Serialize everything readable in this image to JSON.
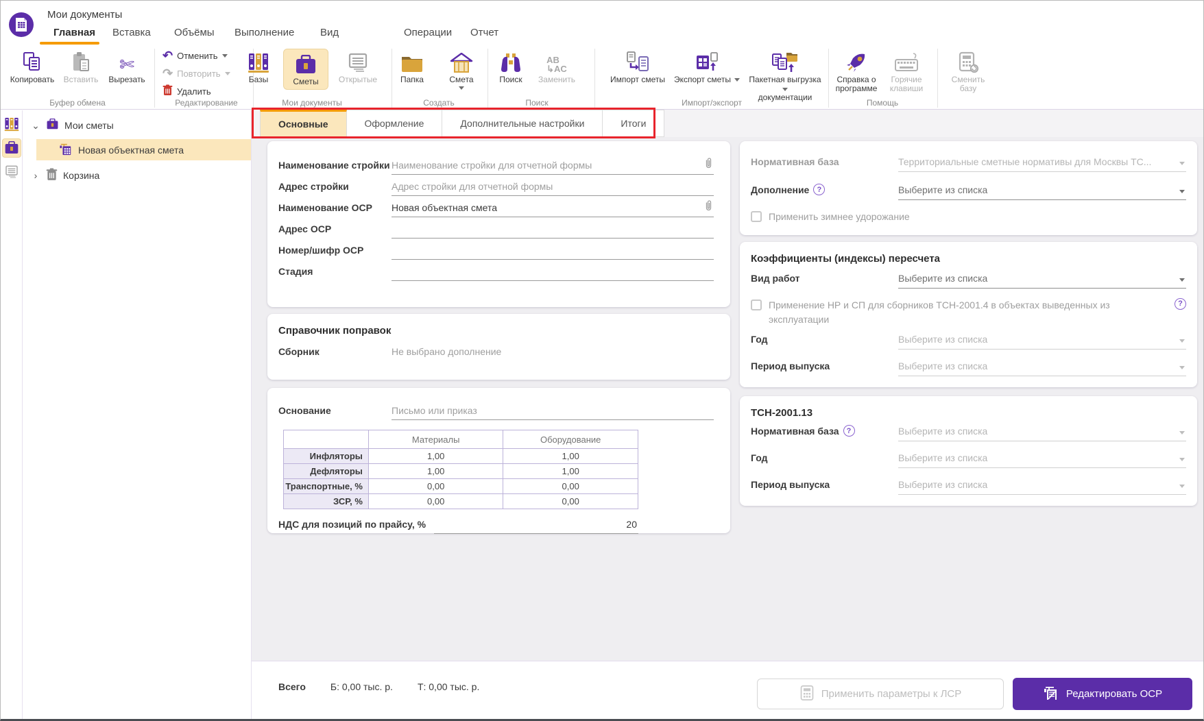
{
  "colors": {
    "accent": "#5b2da8",
    "highlight": "#fbe7bc",
    "active_tab_bar": "#f59b00",
    "annotation": "#e8242c",
    "gold": "#d9a43b"
  },
  "window": {
    "title": "Мои документы"
  },
  "ribbon": {
    "tabs": [
      {
        "label": "Главная"
      },
      {
        "label": "Вставка"
      },
      {
        "label": "Объёмы"
      },
      {
        "label": "Выполнение"
      },
      {
        "label": "Вид"
      },
      {
        "label": "Операции"
      },
      {
        "label": "Отчет"
      }
    ],
    "clipboard": {
      "label": "Буфер обмена",
      "copy": "Копировать",
      "paste": "Вставить",
      "cut": "Вырезать"
    },
    "editing": {
      "label": "Редактирование",
      "undo": "Отменить",
      "redo": "Повторить",
      "delete": "Удалить"
    },
    "documents": {
      "label": "Мои документы",
      "bases": "Базы",
      "estimates": "Сметы",
      "open": "Открытые"
    },
    "create": {
      "label": "Создать",
      "folder": "Папка",
      "estimate": "Смета"
    },
    "search": {
      "label": "Поиск",
      "search": "Поиск",
      "replace": "Заменить"
    },
    "import_export": {
      "label": "Импорт/экспорт",
      "import": "Импорт сметы",
      "export": "Экспорт сметы",
      "batch_line1": "Пакетная выгрузка",
      "batch_line2": "документации"
    },
    "help": {
      "label": "Помощь",
      "about_line1": "Справка о",
      "about_line2": "программе",
      "hotkeys_line1": "Горячие",
      "hotkeys_line2": "клавиши"
    },
    "change_base": {
      "line1": "Сменить",
      "line2": "базу"
    }
  },
  "tree": {
    "items": [
      {
        "label": "Мои сметы"
      },
      {
        "label": "Новая объектная смета"
      },
      {
        "label": "Корзина"
      }
    ]
  },
  "tabs": [
    {
      "label": "Основные"
    },
    {
      "label": "Оформление"
    },
    {
      "label": "Дополнительные настройки"
    },
    {
      "label": "Итоги"
    }
  ],
  "form": {
    "construction_name": {
      "label": "Наименование стройки",
      "placeholder": "Наименование стройки для отчетной формы"
    },
    "construction_address": {
      "label": "Адрес стройки",
      "placeholder": "Адрес стройки для отчетной формы"
    },
    "osr_name": {
      "label": "Наименование ОСР",
      "value": "Новая объектная смета"
    },
    "osr_address": {
      "label": "Адрес ОСР"
    },
    "osr_number": {
      "label": "Номер/шифр ОСР"
    },
    "stage": {
      "label": "Стадия"
    }
  },
  "corrections": {
    "title": "Справочник поправок",
    "collection_label": "Сборник",
    "collection_value": "Не выбрано дополнение"
  },
  "basis": {
    "label": "Основание",
    "placeholder": "Письмо или приказ"
  },
  "factors_table": {
    "columns": [
      "",
      "Материалы",
      "Оборудование"
    ],
    "rows": [
      {
        "label": "Инфляторы",
        "values": [
          "1,00",
          "1,00"
        ]
      },
      {
        "label": "Дефляторы",
        "values": [
          "1,00",
          "1,00"
        ]
      },
      {
        "label": "Транспортные, %",
        "values": [
          "0,00",
          "0,00"
        ]
      },
      {
        "label": "ЗСР, %",
        "values": [
          "0,00",
          "0,00"
        ]
      }
    ]
  },
  "vat": {
    "label": "НДС для позиций по прайсу, %",
    "value": "20"
  },
  "normative": {
    "base": {
      "label": "Нормативная база",
      "value": "Территориальные сметные нормативы для Москвы ТС..."
    },
    "addition": {
      "label": "Дополнение",
      "placeholder": "Выберите из списка"
    },
    "winter_checkbox": "Применить зимнее удорожание"
  },
  "coefficients": {
    "title": "Коэффициенты (индексы) пересчета",
    "work_type": {
      "label": "Вид работ",
      "placeholder": "Выберите из списка"
    },
    "nr_sp_checkbox": "Применение НР и СП для сборников ТСН-2001.4 в объектах выведенных из эксплуатации",
    "year": {
      "label": "Год",
      "placeholder": "Выберите из списка"
    },
    "period": {
      "label": "Период выпуска",
      "placeholder": "Выберите из списка"
    }
  },
  "tsn": {
    "title": "ТСН-2001.13",
    "base": {
      "label": "Нормативная база",
      "placeholder": "Выберите из списка"
    },
    "year": {
      "label": "Год",
      "placeholder": "Выберите из списка"
    },
    "period": {
      "label": "Период выпуска",
      "placeholder": "Выберите из списка"
    }
  },
  "footer": {
    "total_label": "Всего",
    "base_total": "Б: 0,00 тыс. р.",
    "current_total": "Т: 0,00 тыс. р.",
    "apply_button": "Применить параметры к ЛСР",
    "edit_button": "Редактировать ОСР"
  }
}
